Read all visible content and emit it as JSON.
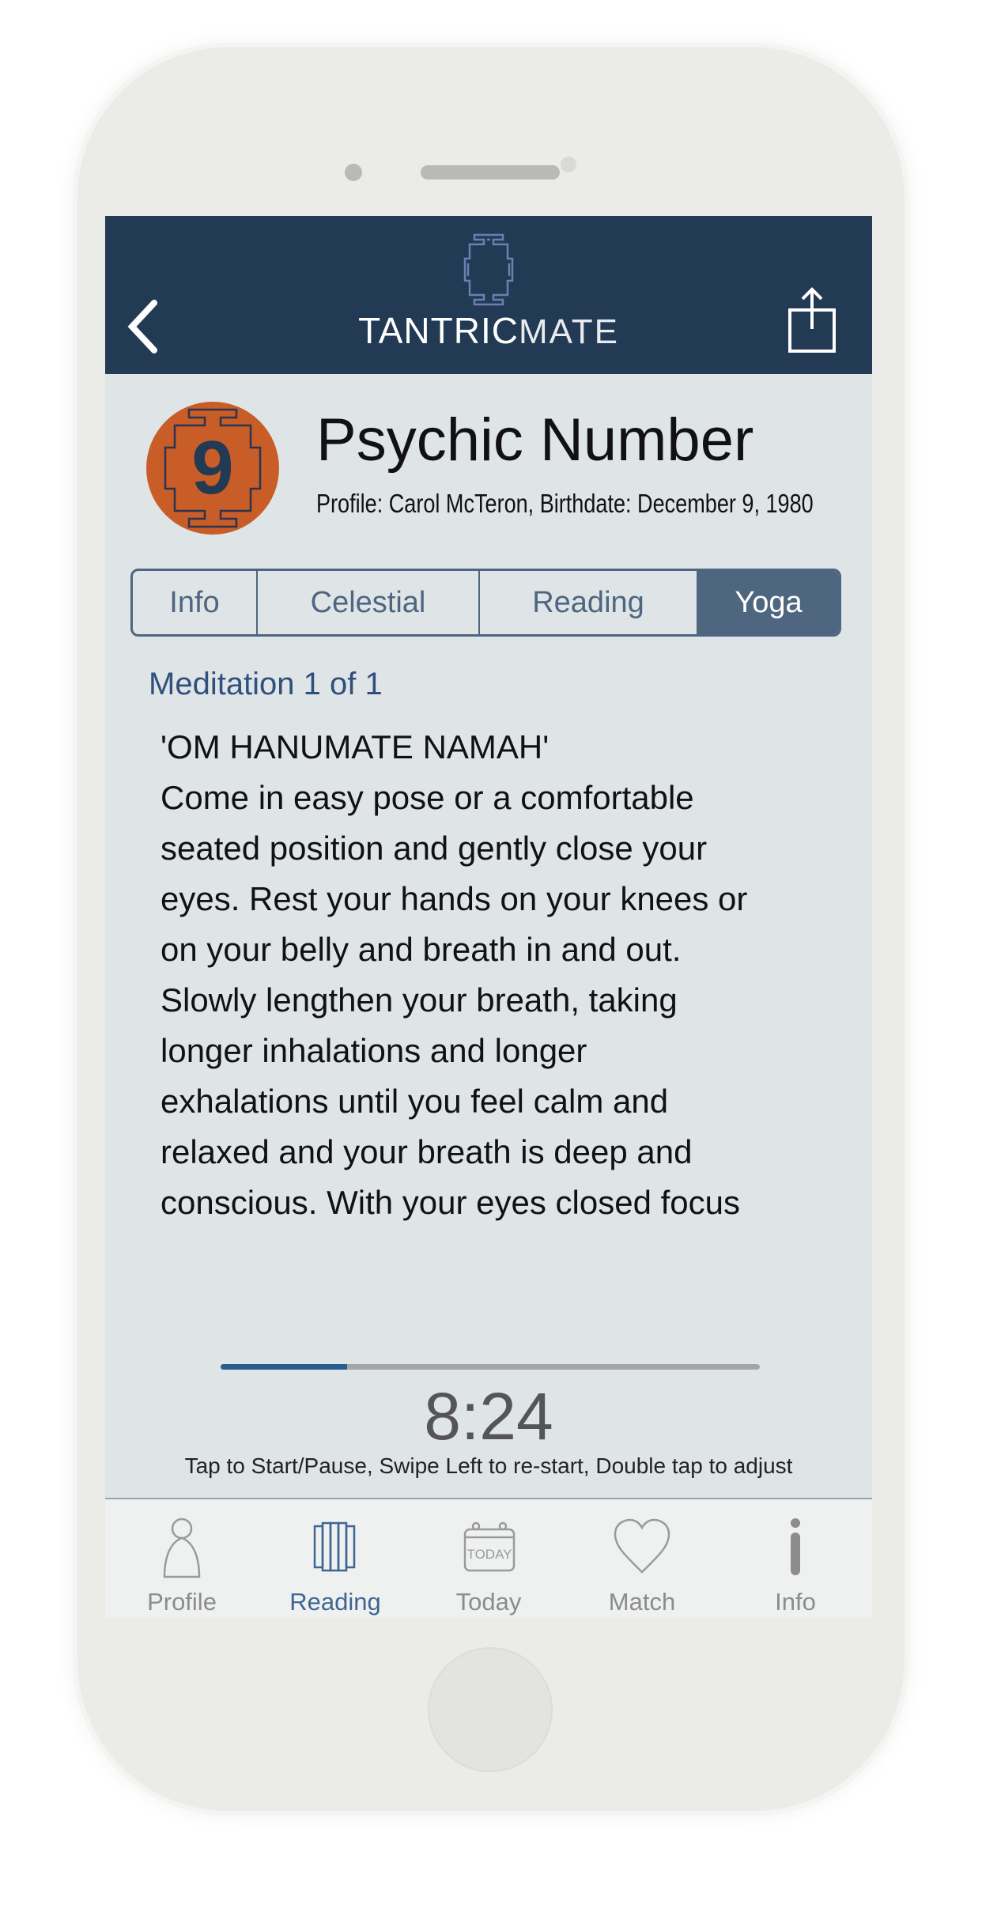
{
  "header": {
    "logo_bold": "TANTRIC",
    "logo_light": "MATE",
    "back_icon": "chevron-left-icon",
    "share_icon": "share-icon"
  },
  "badge": {
    "number": "9",
    "color": "#c85d28"
  },
  "title": "Psychic Number",
  "subtitle": "Profile: Carol McTeron, Birthdate: December 9, 1980",
  "tabs": [
    {
      "label": "Info",
      "active": false
    },
    {
      "label": "Celestial",
      "active": false
    },
    {
      "label": "Reading",
      "active": false
    },
    {
      "label": "Yoga",
      "active": true
    }
  ],
  "meditation": {
    "counter": "Meditation 1 of 1",
    "lines": [
      "'OM HANUMATE NAMAH'",
      "Come in easy pose or a comfortable",
      "seated position and gently close your",
      "eyes. Rest your hands on your knees or",
      "on your belly and breath in and out.",
      "Slowly lengthen your breath, taking",
      "longer inhalations and longer",
      "exhalations until you feel calm and",
      "relaxed and your breath is deep and",
      "conscious. With your eyes closed focus"
    ]
  },
  "timer": {
    "progress_percent": 23.5,
    "time": "8:24",
    "hint": "Tap to Start/Pause, Swipe Left to re-start, Double tap to adjust"
  },
  "tabbar": {
    "items": [
      {
        "label": "Profile",
        "icon": "person-icon",
        "active": false
      },
      {
        "label": "Reading",
        "icon": "book-icon",
        "active": true
      },
      {
        "label": "Today",
        "icon": "calendar-icon",
        "active": false,
        "icon_text": "TODAY"
      },
      {
        "label": "Match",
        "icon": "heart-icon",
        "active": false
      },
      {
        "label": "Info",
        "icon": "info-icon",
        "active": false
      }
    ]
  },
  "colors": {
    "header": "#223a54",
    "accent": "#4e6680",
    "progress": "#2c5d92"
  }
}
